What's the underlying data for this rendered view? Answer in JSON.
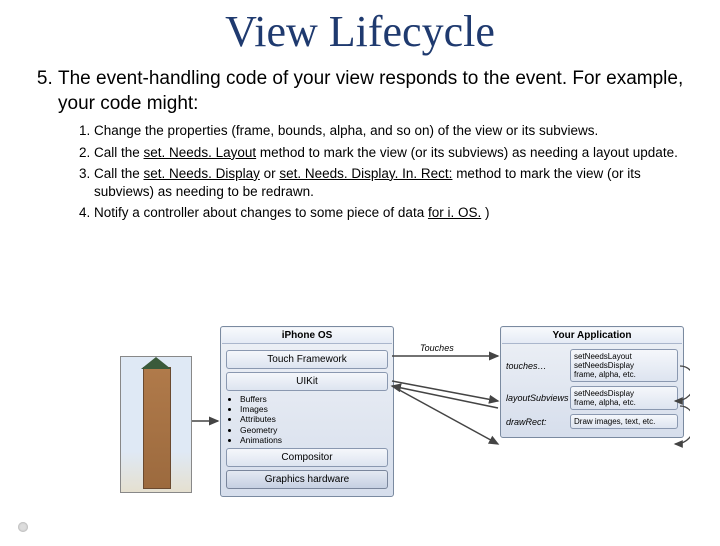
{
  "title": "View Lifecycle",
  "main_item": {
    "number": "5.",
    "text": "The event-handling code of your view responds to the event. For example, your code might:"
  },
  "subitems": [
    "Change the properties (frame, bounds, alpha, and so on) of the view or its subviews.",
    {
      "pre": "Call the ",
      "u1": "set. Needs. Layout",
      "post": " method to mark the view (or its subviews) as needing a layout update."
    },
    {
      "pre": "Call the ",
      "u1": "set. Needs. Display",
      "mid": " or ",
      "u2": "set. Needs. Display. In. Rect:",
      "post": " method to mark the view (or its subviews) as needing to be redrawn."
    },
    {
      "pre": "Notify a controller about changes to some piece of data ",
      "u1": "for i. OS.",
      "post": " )"
    }
  ],
  "iphone": {
    "header": "iPhone OS",
    "rows": [
      "Touch Framework",
      "UIKit",
      "Compositor",
      "Graphics hardware"
    ],
    "bullets": [
      "Buffers",
      "Images",
      "Attributes",
      "Geometry",
      "Animations"
    ]
  },
  "app": {
    "header": "Your Application",
    "rows": [
      {
        "label": "touches…",
        "pill": "setNeedsLayout\nsetNeedsDisplay\nframe, alpha, etc."
      },
      {
        "label": "layoutSubviews",
        "pill": "setNeedsDisplay\nframe, alpha, etc."
      },
      {
        "label": "drawRect:",
        "pill": "Draw images, text, etc."
      }
    ]
  },
  "arrow_labels": {
    "touches": "Touches"
  }
}
